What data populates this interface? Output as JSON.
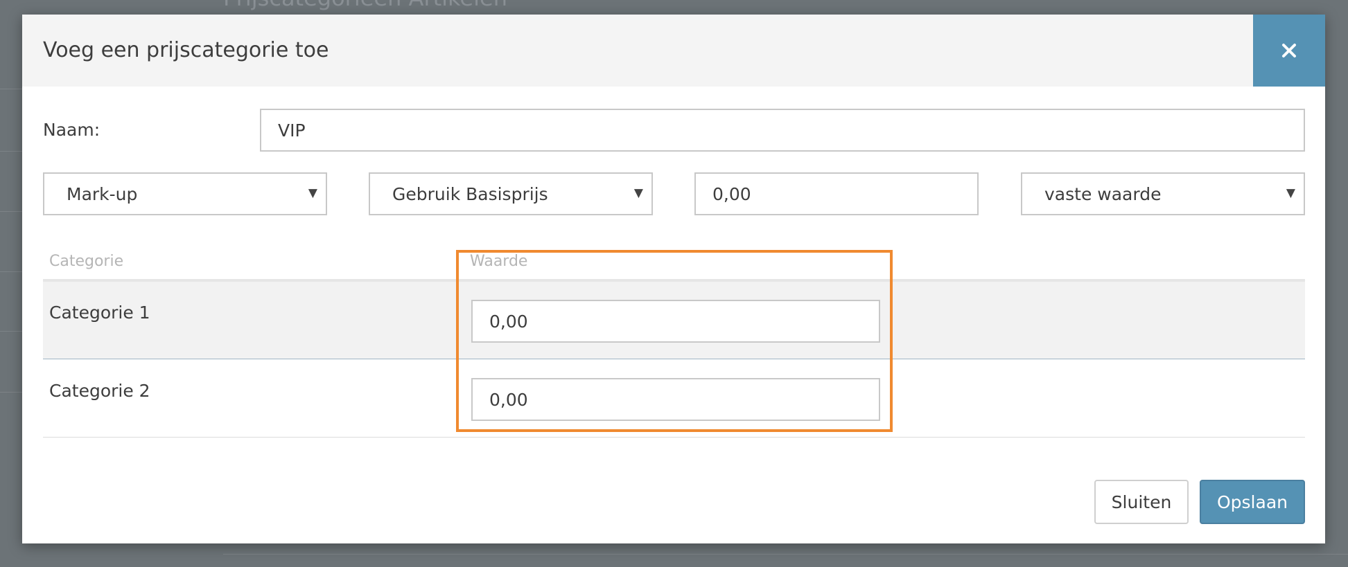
{
  "background": {
    "page_title": "Prijscategorieën Artikelen"
  },
  "modal": {
    "title": "Voeg een prijscategorie toe",
    "close_icon": "close-icon",
    "name_label": "Naam:",
    "name_value": "VIP",
    "type_select": "Mark-up",
    "base_select": "Gebruik Basisprijs",
    "amount_value": "0,00",
    "mode_select": "vaste waarde",
    "table": {
      "headers": [
        "Categorie",
        "Waarde"
      ],
      "rows": [
        {
          "category": "Categorie 1",
          "value": "0,00"
        },
        {
          "category": "Categorie 2",
          "value": "0,00"
        }
      ]
    },
    "buttons": {
      "close_label": "Sluiten",
      "save_label": "Opslaan"
    }
  },
  "colors": {
    "accent": "#5592b4",
    "highlight": "#f08a30"
  }
}
